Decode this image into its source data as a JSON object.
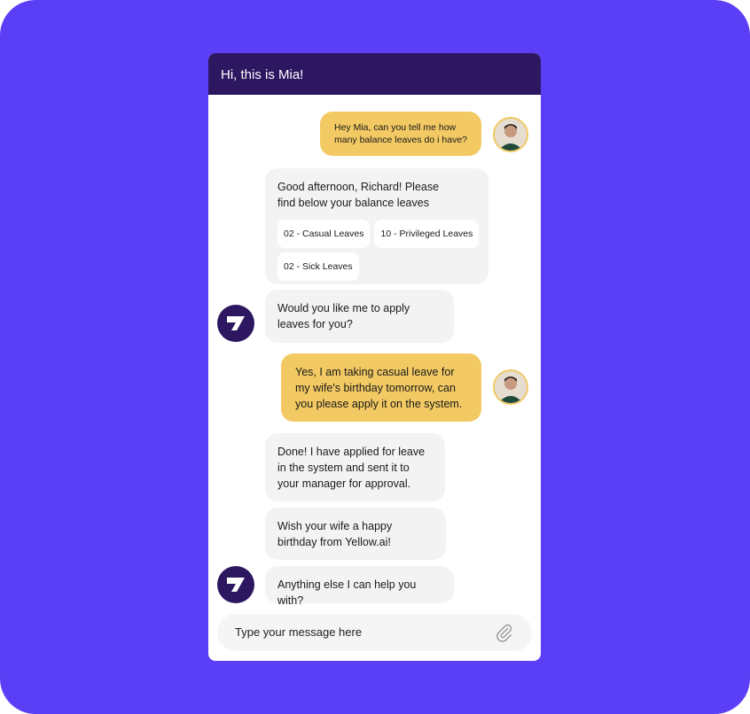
{
  "header": {
    "title": "Hi, this is Mia!"
  },
  "colors": {
    "background": "#5b3ff6",
    "header": "#2c1760",
    "user_bubble": "#f2c963",
    "bot_bubble": "#f3f3f3"
  },
  "messages": [
    {
      "from": "user",
      "text": "Hey Mia, can you tell me how many balance leaves do i have?"
    },
    {
      "from": "bot",
      "text": "Good afternoon, Richard! Please find below your balance leaves",
      "chips": [
        "02 - Casual Leaves",
        "10 - Privileged Leaves",
        "02 - Sick Leaves"
      ]
    },
    {
      "from": "bot",
      "text": "Would you like me to apply leaves for you?"
    },
    {
      "from": "user",
      "text": "Yes, I am taking casual leave for my wife's birthday tomorrow, can you please apply it on the system."
    },
    {
      "from": "bot",
      "text": "Done! I have applied for leave in the system and sent it to your manager for approval."
    },
    {
      "from": "bot",
      "text": "Wish your wife a happy birthday from Yellow.ai!"
    },
    {
      "from": "bot",
      "text": "Anything else I can help you with?"
    }
  ],
  "composer": {
    "placeholder": "Type your message here",
    "attach_icon": "paperclip-icon"
  }
}
